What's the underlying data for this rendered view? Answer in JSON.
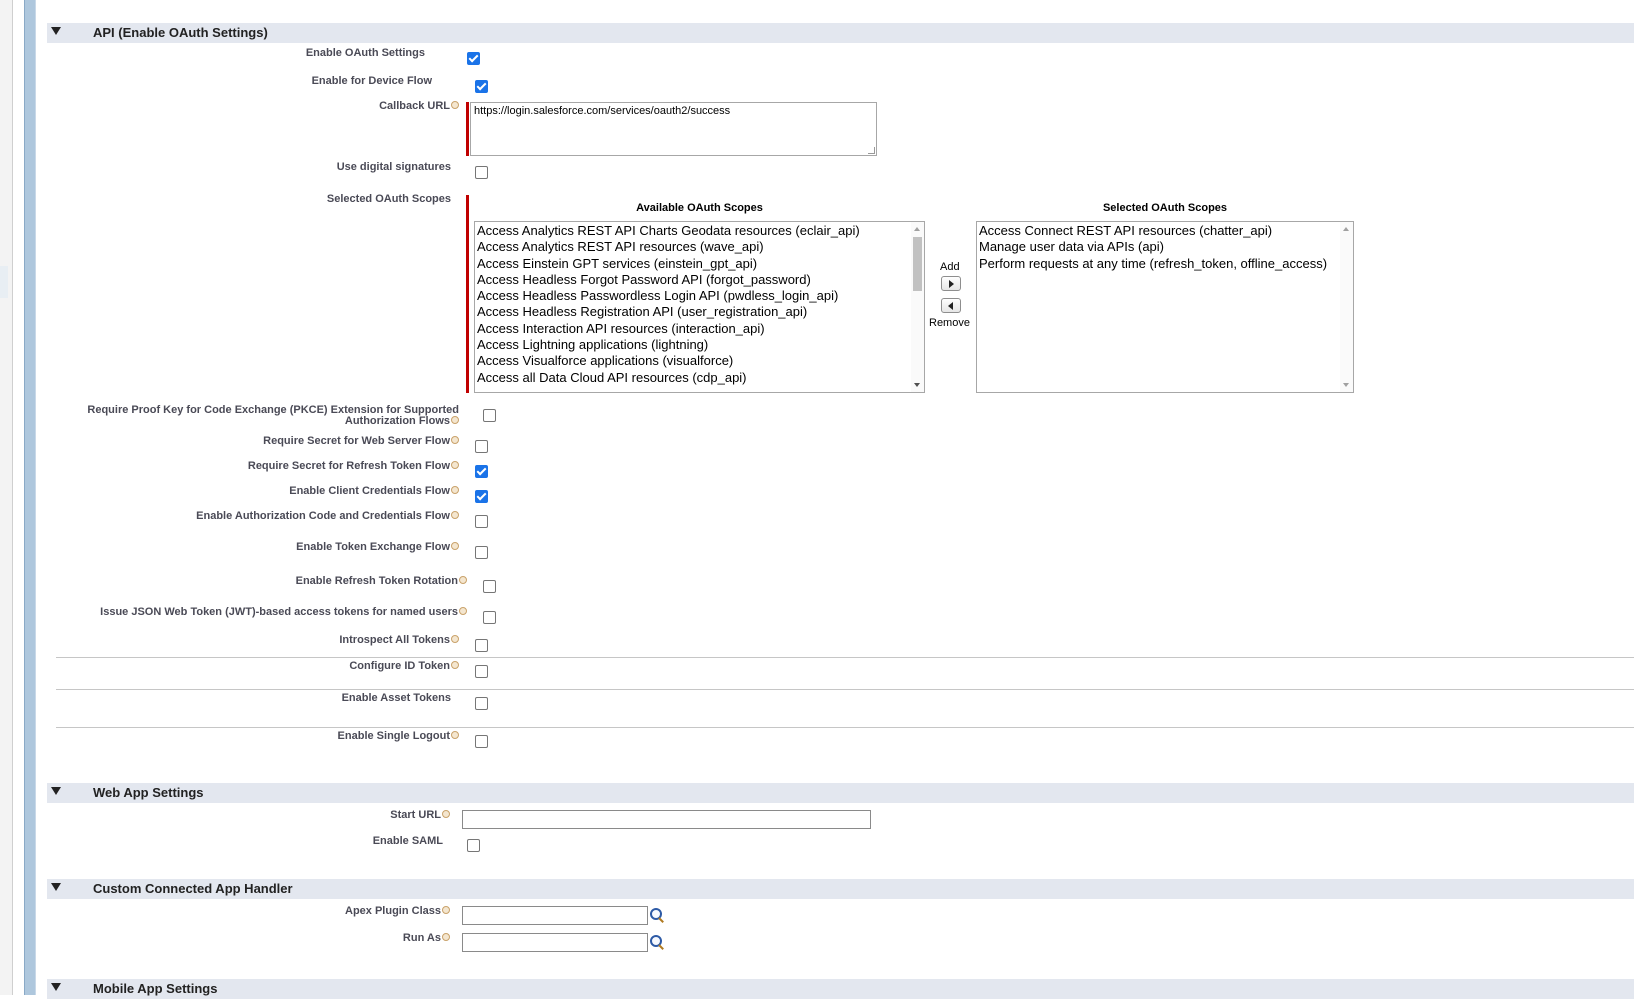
{
  "oauth_section": {
    "title": "API (Enable OAuth Settings)",
    "enable_oauth_label": "Enable OAuth Settings",
    "enable_oauth_checked": true,
    "device_flow_label": "Enable for Device Flow",
    "device_flow_checked": true,
    "callback_url_label": "Callback URL",
    "callback_url_value": "https://login.salesforce.com/services/oauth2/success",
    "digital_signatures_label": "Use digital signatures",
    "digital_signatures_checked": false,
    "selected_scopes_label": "Selected OAuth Scopes",
    "available_scopes_header": "Available OAuth Scopes",
    "selected_scopes_header": "Selected OAuth Scopes",
    "add_label": "Add",
    "remove_label": "Remove",
    "available_scopes": [
      "Access Analytics REST API Charts Geodata resources (eclair_api)",
      "Access Analytics REST API resources (wave_api)",
      "Access Einstein GPT services (einstein_gpt_api)",
      "Access Headless Forgot Password API (forgot_password)",
      "Access Headless Passwordless Login API (pwdless_login_api)",
      "Access Headless Registration API (user_registration_api)",
      "Access Interaction API resources (interaction_api)",
      "Access Lightning applications (lightning)",
      "Access Visualforce applications (visualforce)",
      "Access all Data Cloud API resources (cdp_api)"
    ],
    "selected_scopes": [
      "Access Connect REST API resources (chatter_api)",
      "Manage user data via APIs (api)",
      "Perform requests at any time (refresh_token, offline_access)"
    ],
    "pkce_label_line1": "Require Proof Key for Code Exchange (PKCE) Extension for Supported",
    "pkce_label_line2": "Authorization Flows",
    "pkce_checked": false,
    "secret_web_server_label": "Require Secret for Web Server Flow",
    "secret_web_server_checked": false,
    "secret_refresh_label": "Require Secret for Refresh Token Flow",
    "secret_refresh_checked": true,
    "client_credentials_label": "Enable Client Credentials Flow",
    "client_credentials_checked": true,
    "auth_code_credentials_label": "Enable Authorization Code and Credentials Flow",
    "auth_code_credentials_checked": false,
    "token_exchange_label": "Enable Token Exchange Flow",
    "token_exchange_checked": false,
    "refresh_rotation_label": "Enable Refresh Token Rotation",
    "refresh_rotation_checked": false,
    "jwt_label": "Issue JSON Web Token (JWT)-based access tokens for named users",
    "jwt_checked": false,
    "introspect_label": "Introspect All Tokens",
    "introspect_checked": false,
    "id_token_label": "Configure ID Token",
    "id_token_checked": false,
    "asset_tokens_label": "Enable Asset Tokens",
    "asset_tokens_checked": false,
    "single_logout_label": "Enable Single Logout",
    "single_logout_checked": false
  },
  "web_app_section": {
    "title": "Web App Settings",
    "start_url_label": "Start URL",
    "start_url_value": "",
    "enable_saml_label": "Enable SAML",
    "enable_saml_checked": false
  },
  "handler_section": {
    "title": "Custom Connected App Handler",
    "apex_plugin_label": "Apex Plugin Class",
    "apex_plugin_value": "",
    "run_as_label": "Run As",
    "run_as_value": ""
  },
  "mobile_section": {
    "title": "Mobile App Settings"
  },
  "colors": {
    "section_bar": "#e3e7ef",
    "required_bar": "#c00000",
    "checkbox_on": "#1a73e8",
    "label_text": "#4a4a56"
  }
}
